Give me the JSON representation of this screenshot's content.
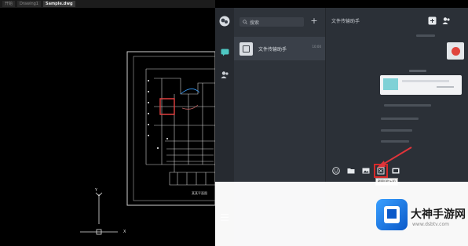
{
  "cad": {
    "tabs": [
      {
        "label": "开始"
      },
      {
        "label": "Drawing1"
      },
      {
        "label": "Sample.dwg"
      }
    ],
    "drawing_title": "某某平面图"
  },
  "wechat": {
    "search": {
      "placeholder": "搜索"
    },
    "chat_item": {
      "name": "文件传输助手",
      "time": "10:00"
    },
    "chat_title": "文件传输助手",
    "tooltip": "截图(Alt+A)"
  },
  "watermark": {
    "name": "大神手游网",
    "url": "www.dsbtv.com"
  },
  "colors": {
    "accent": "#d72a2a",
    "wechat_bg": "#2b3037",
    "file_icon": "#7fd1d6"
  },
  "icons": [
    "wechat-logo-icon",
    "chat-icon",
    "contacts-icon",
    "menu-icon",
    "search-icon",
    "add-icon",
    "new-chat-icon",
    "add-member-icon",
    "emoji-icon",
    "folder-icon",
    "image-icon",
    "screenshot-icon",
    "video-icon",
    "arrow-pointer"
  ]
}
